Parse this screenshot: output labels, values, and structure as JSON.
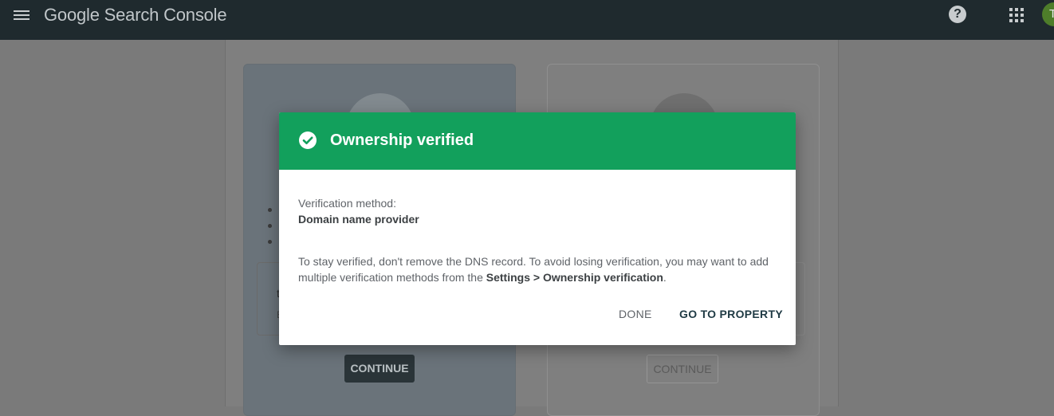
{
  "app": {
    "title": "Google Search Console",
    "avatar_initial": "T"
  },
  "topbar": {
    "help_label": "?"
  },
  "background": {
    "continue_left": "CONTINUE",
    "continue_right": "CONTINUE",
    "fragment_1": "t",
    "fragment_2": "E"
  },
  "dialog": {
    "title": "Ownership verified",
    "method_label": "Verification method:",
    "method_value": "Domain name provider",
    "body_prefix": "To stay verified, don't remove the DNS record. To avoid losing verification, you may want to add multiple verification methods from the ",
    "body_bold": "Settings > Ownership verification",
    "body_suffix": ".",
    "done_label": "DONE",
    "go_label": "GO TO PROPERTY"
  },
  "colors": {
    "header_green": "#12a05c",
    "topbar": "#1f2a2e"
  }
}
